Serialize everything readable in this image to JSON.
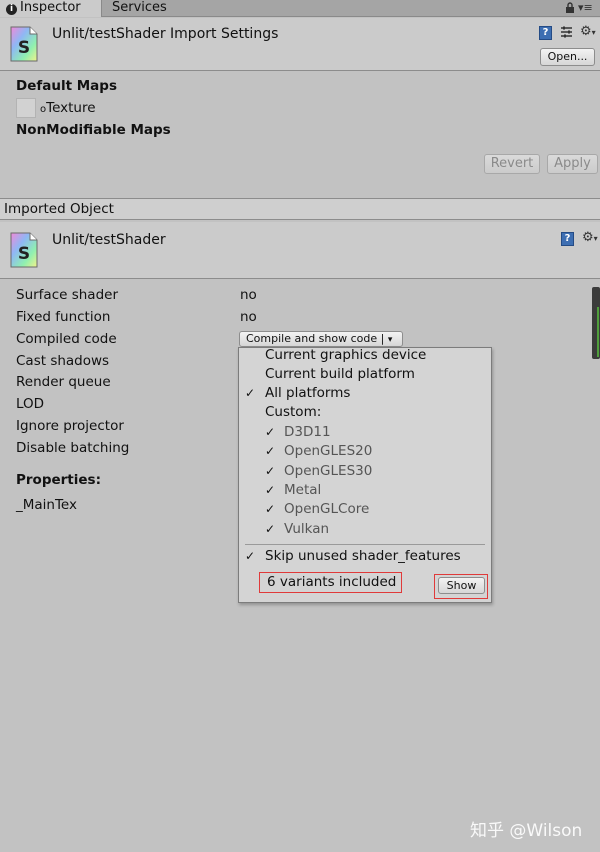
{
  "tabs": {
    "inspector": "Inspector",
    "services": "Services",
    "lock_icon": "lock-icon",
    "menu_icon": "menu-icon"
  },
  "import_header": {
    "title": "Unlit/testShader Import Settings",
    "open_label": "Open...",
    "help_label": "?"
  },
  "default_maps": {
    "heading": "Default Maps",
    "texture_label": "Texture",
    "nonmodifiable_heading": "NonModifiable Maps"
  },
  "actions": {
    "revert_label": "Revert",
    "apply_label": "Apply"
  },
  "imported_object": {
    "bar_label": "Imported Object",
    "title": "Unlit/testShader",
    "help_label": "?"
  },
  "properties": {
    "rows": [
      {
        "label": "Surface shader",
        "value": "no"
      },
      {
        "label": "Fixed function",
        "value": "no"
      },
      {
        "label": "Compiled code",
        "value": ""
      },
      {
        "label": "Cast shadows",
        "value": ""
      },
      {
        "label": "Render queue",
        "value": ""
      },
      {
        "label": "LOD",
        "value": ""
      },
      {
        "label": "Ignore projector",
        "value": ""
      },
      {
        "label": "Disable batching",
        "value": ""
      }
    ],
    "heading": "Properties:",
    "maintex": "_MainTex"
  },
  "compile_dropdown": {
    "label": "Compile and show code |",
    "arrow": "▾"
  },
  "menu": {
    "items": [
      {
        "label": "Current graphics device",
        "checked": false
      },
      {
        "label": "Current build platform",
        "checked": false
      },
      {
        "label": "All platforms",
        "checked": true
      },
      {
        "label": "Custom:",
        "checked": false
      }
    ],
    "custom_items": [
      {
        "label": "D3D11",
        "checked": true
      },
      {
        "label": "OpenGLES20",
        "checked": true
      },
      {
        "label": "OpenGLES30",
        "checked": true
      },
      {
        "label": "Metal",
        "checked": true
      },
      {
        "label": "OpenGLCore",
        "checked": true
      },
      {
        "label": "Vulkan",
        "checked": true
      }
    ],
    "skip_label": "Skip unused shader_features",
    "variants_label": "6 variants included",
    "show_label": "Show",
    "check_glyph": "✓"
  },
  "watermark": "知乎 @Wilson",
  "colors": {
    "background": "#c2c2c2",
    "highlight_box": "#e03a3a",
    "help_blue": "#3d6eb2"
  }
}
